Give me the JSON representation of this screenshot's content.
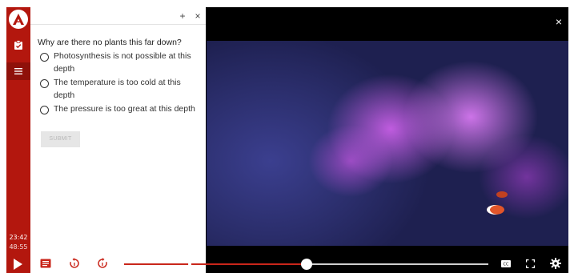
{
  "colors": {
    "accent": "#b3170e",
    "progress": "#c9261b"
  },
  "rail": {
    "logo_icon": "a-logo-icon",
    "items": [
      {
        "name": "quiz-check-icon"
      },
      {
        "name": "menu-list-icon",
        "active": true
      }
    ],
    "elapsed_time": "23:42",
    "total_time": "48:55"
  },
  "panel": {
    "add_label": "+",
    "close_label": "×",
    "question": "Why are there no plants this far down?",
    "options": [
      "Photosynthesis is not possible at this depth",
      "The temperature is too cold at this depth",
      "The pressure is too great at this depth"
    ],
    "submit_label": "SUBMIT"
  },
  "video": {
    "close_label": "×"
  },
  "controls": {
    "progress": 0.5,
    "marker": 0.18,
    "icons": [
      "play-icon",
      "notes-icon",
      "rewind-icon",
      "forward-icon",
      "captions-icon",
      "fullscreen-icon",
      "settings-icon"
    ]
  }
}
